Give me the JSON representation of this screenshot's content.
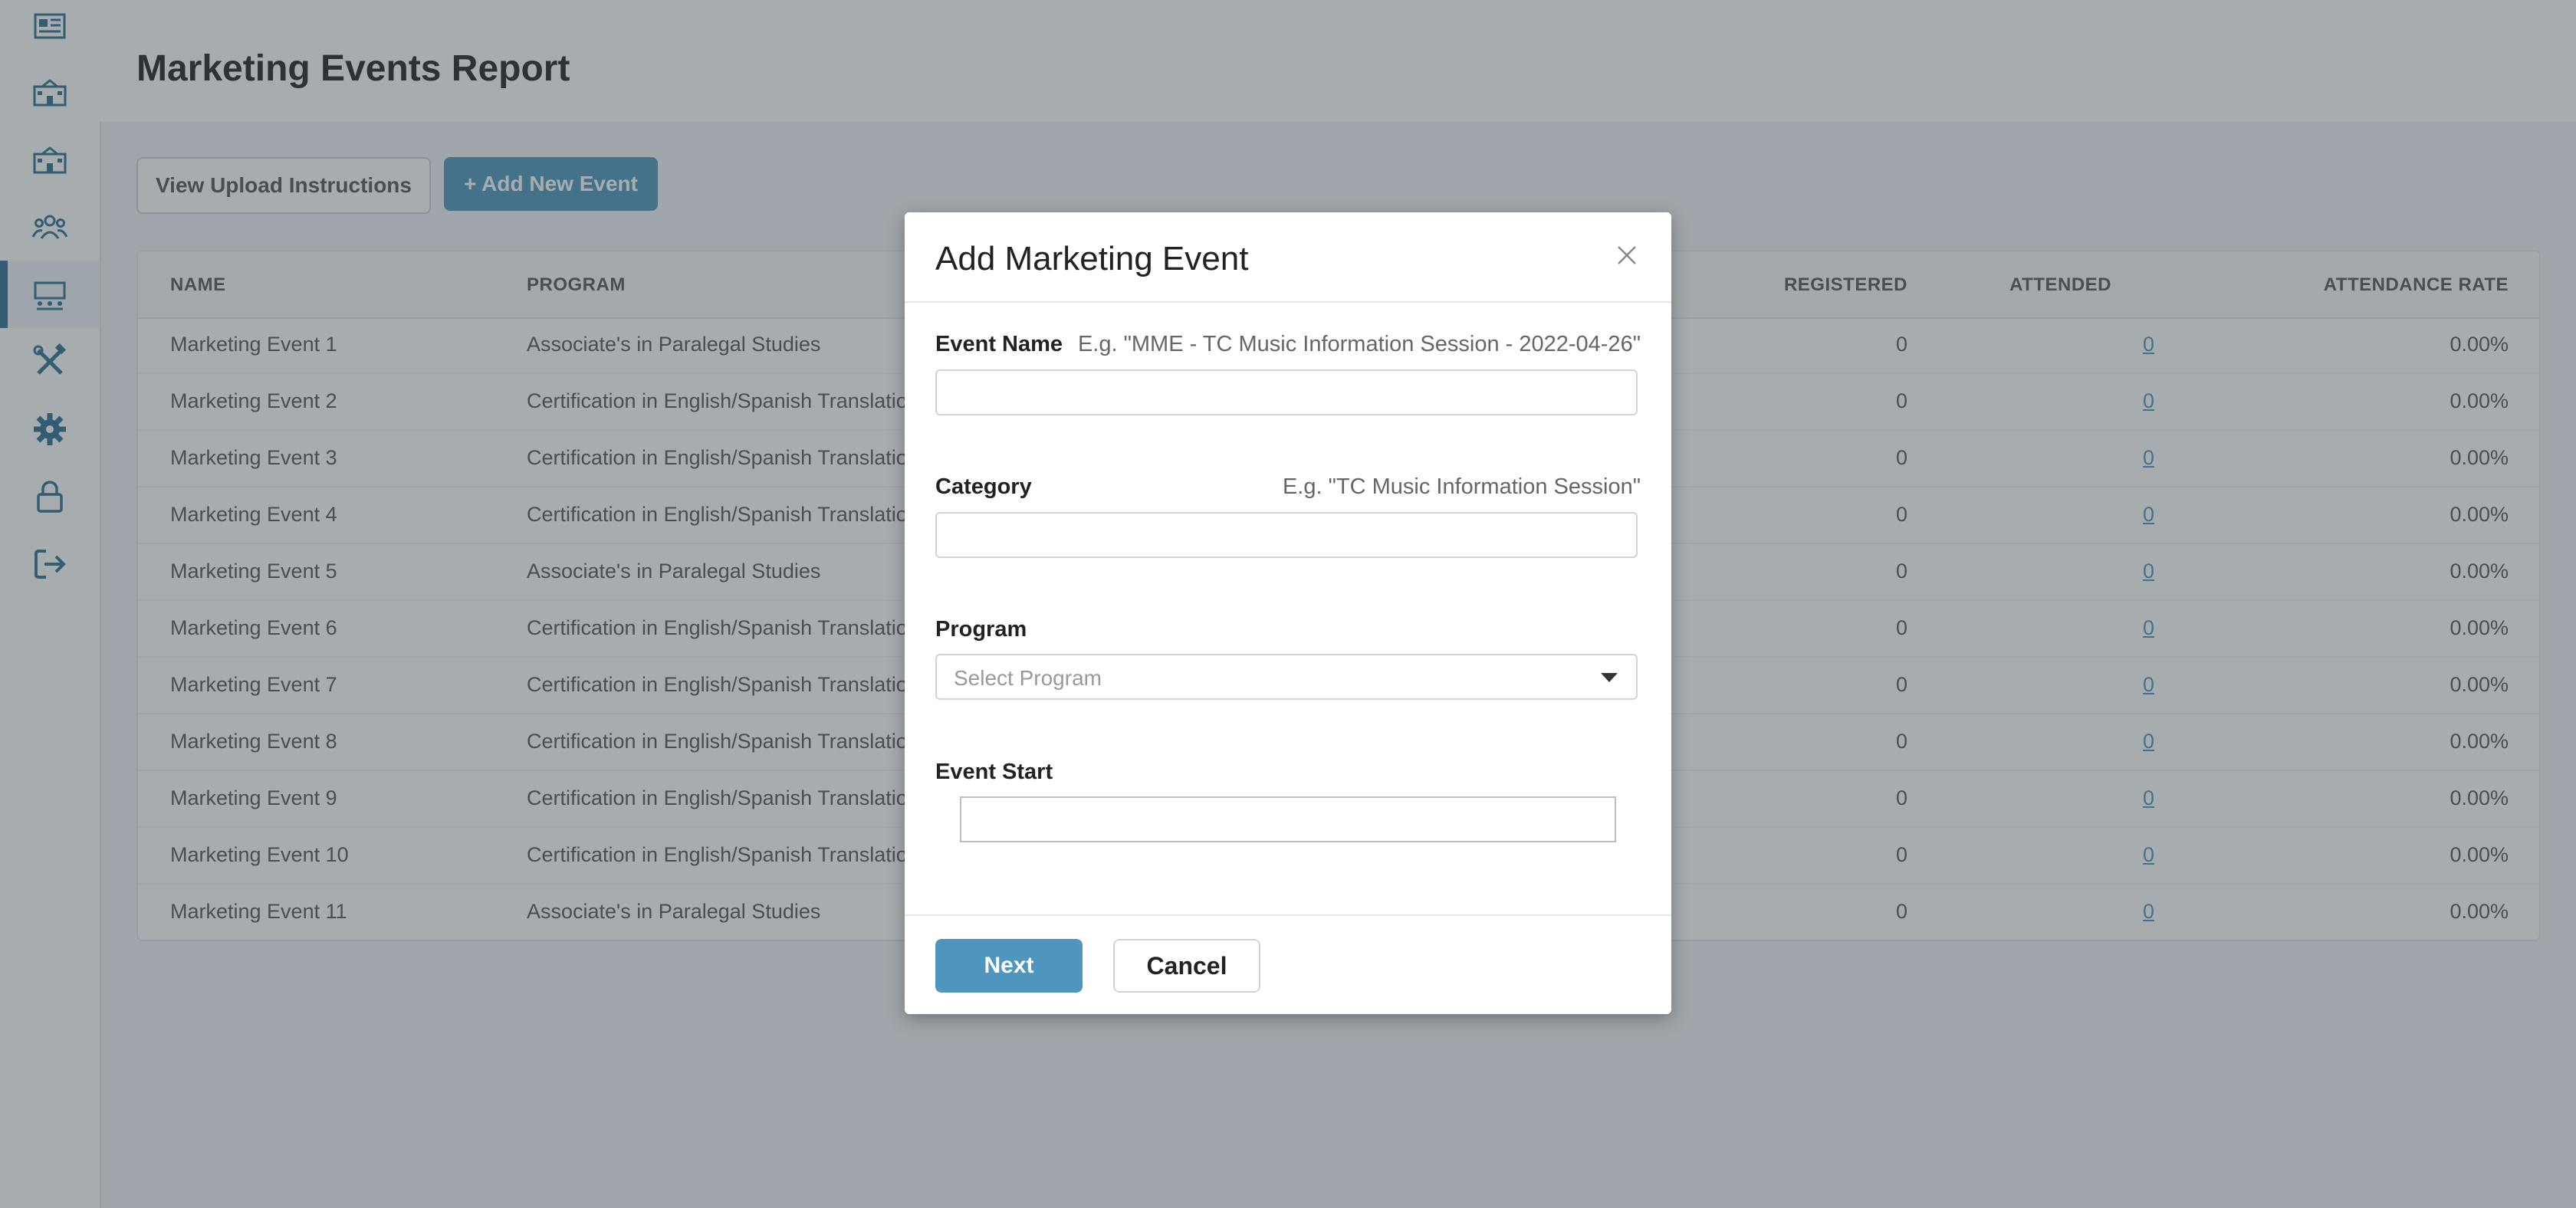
{
  "sidebar": {
    "items": [
      {
        "icon": "newspaper-icon"
      },
      {
        "icon": "school-building-icon"
      },
      {
        "icon": "school-building-alt-icon"
      },
      {
        "icon": "users-group-icon"
      },
      {
        "icon": "presentation-icon",
        "active": true
      },
      {
        "icon": "tools-icon"
      },
      {
        "icon": "gear-icon"
      },
      {
        "icon": "lock-icon"
      },
      {
        "icon": "logout-icon"
      }
    ]
  },
  "header": {
    "title": "Marketing Events Report"
  },
  "toolbar": {
    "upload_instructions_label": "View Upload Instructions",
    "add_event_label": "+ Add New Event"
  },
  "table": {
    "columns": [
      "NAME",
      "PROGRAM",
      "REGISTERED",
      "ATTENDED",
      "ATTENDANCE RATE"
    ],
    "rows": [
      {
        "name": "Marketing Event 1",
        "program": "Associate's in Paralegal Studies",
        "registered": "0",
        "attended": "0",
        "rate": "0.00%"
      },
      {
        "name": "Marketing Event 2",
        "program": "Certification in English/Spanish Translation S",
        "registered": "0",
        "attended": "0",
        "rate": "0.00%"
      },
      {
        "name": "Marketing Event 3",
        "program": "Certification in English/Spanish Translation S",
        "registered": "0",
        "attended": "0",
        "rate": "0.00%"
      },
      {
        "name": "Marketing Event 4",
        "program": "Certification in English/Spanish Translation S",
        "registered": "0",
        "attended": "0",
        "rate": "0.00%"
      },
      {
        "name": "Marketing Event 5",
        "program": "Associate's in Paralegal Studies",
        "registered": "0",
        "attended": "0",
        "rate": "0.00%"
      },
      {
        "name": "Marketing Event 6",
        "program": "Certification in English/Spanish Translation S",
        "registered": "0",
        "attended": "0",
        "rate": "0.00%"
      },
      {
        "name": "Marketing Event 7",
        "program": "Certification in English/Spanish Translation S",
        "registered": "0",
        "attended": "0",
        "rate": "0.00%"
      },
      {
        "name": "Marketing Event 8",
        "program": "Certification in English/Spanish Translation S",
        "registered": "0",
        "attended": "0",
        "rate": "0.00%"
      },
      {
        "name": "Marketing Event 9",
        "program": "Certification in English/Spanish Translation S",
        "registered": "0",
        "attended": "0",
        "rate": "0.00%"
      },
      {
        "name": "Marketing Event 10",
        "program": "Certification in English/Spanish Translation S",
        "registered": "0",
        "attended": "0",
        "rate": "0.00%"
      },
      {
        "name": "Marketing Event 11",
        "program": "Associate's in Paralegal Studies",
        "registered": "0",
        "attended": "0",
        "rate": "0.00%"
      }
    ]
  },
  "modal": {
    "title": "Add Marketing Event",
    "close_icon": "close-icon",
    "fields": {
      "event_name": {
        "label": "Event Name",
        "hint": "E.g. \"MME - TC Music Information Session - 2022-04-26\"",
        "value": ""
      },
      "category": {
        "label": "Category",
        "hint": "E.g. \"TC Music Information Session\"",
        "value": ""
      },
      "program": {
        "label": "Program",
        "placeholder": "Select Program"
      },
      "event_start": {
        "label": "Event Start",
        "value": ""
      }
    },
    "next_label": "Next",
    "cancel_label": "Cancel"
  },
  "colors": {
    "accent": "#4e96be",
    "active_indicator": "#2d6f92",
    "link": "#4e96be"
  }
}
